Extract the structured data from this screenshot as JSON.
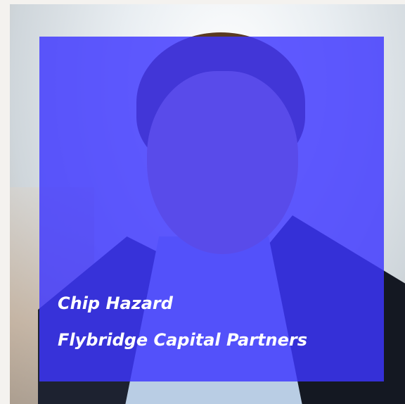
{
  "profile": {
    "name": "Chip Hazard",
    "company": "Flybridge Capital Partners",
    "overlay_color": "#3d36ff",
    "text_color": "#ffffff"
  }
}
